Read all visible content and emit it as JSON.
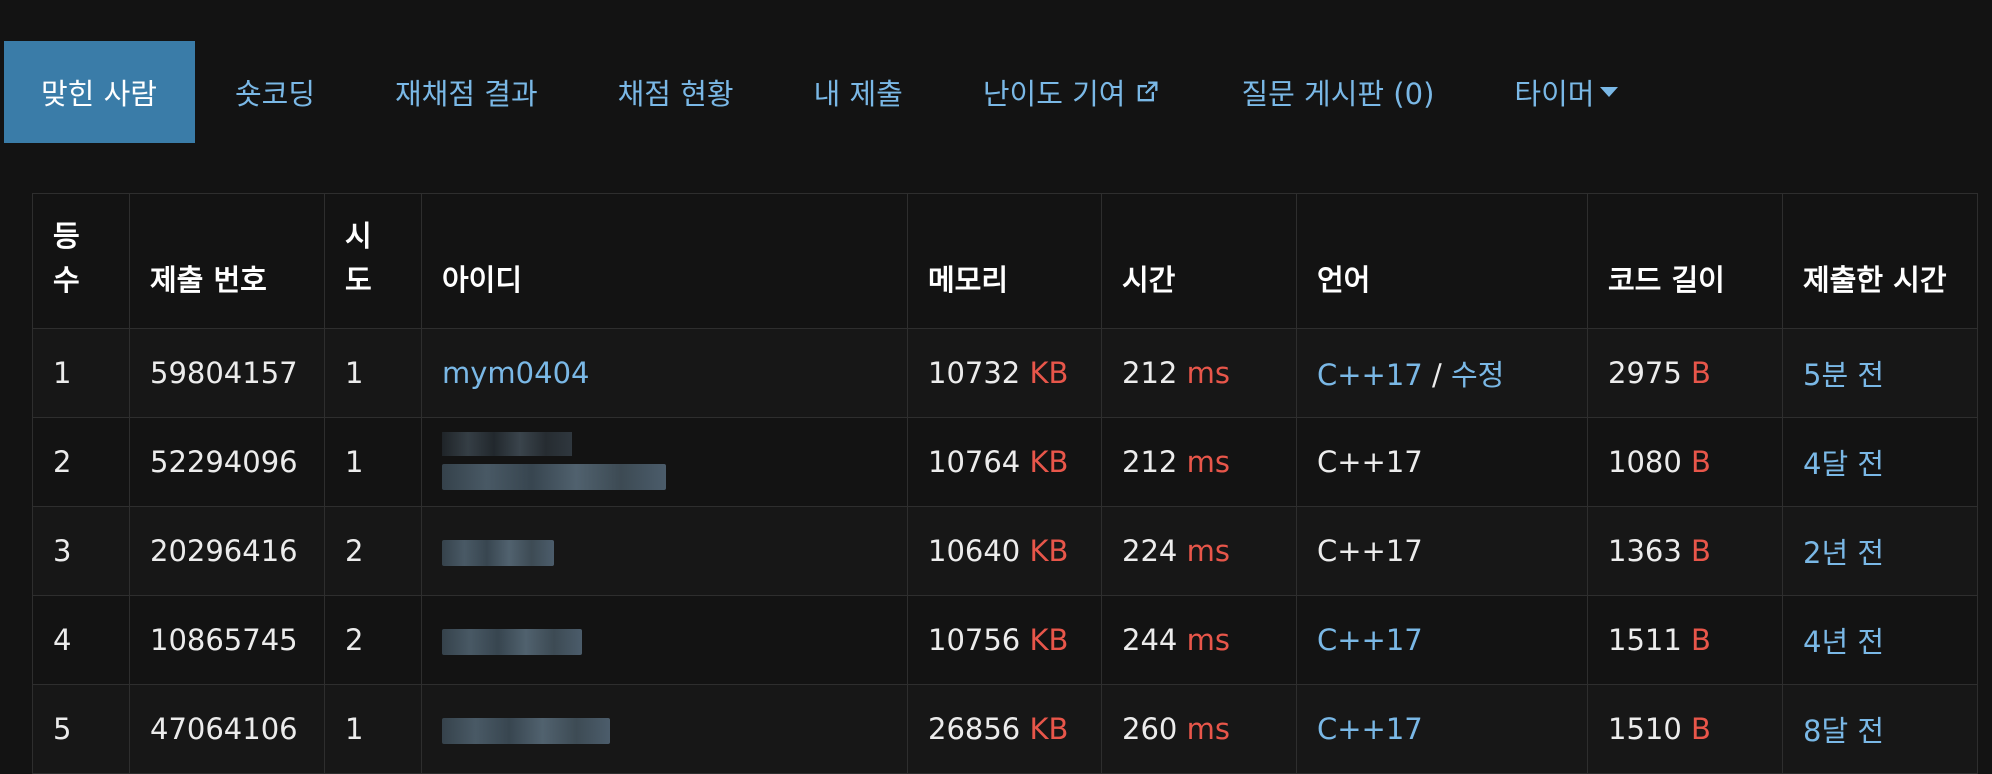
{
  "tabs": [
    {
      "label": "맞힌 사람",
      "active": true
    },
    {
      "label": "숏코딩"
    },
    {
      "label": "재채점 결과"
    },
    {
      "label": "채점 현황"
    },
    {
      "label": "내 제출"
    },
    {
      "label": "난이도 기여",
      "icon": "external-link-icon"
    },
    {
      "label": "질문 게시판 (0)"
    },
    {
      "label": "타이머",
      "icon": "caret-down-icon"
    }
  ],
  "table": {
    "headers": {
      "rank": "등\n수",
      "submission": "제출 번호",
      "tries": "시\n도",
      "user": "아이디",
      "memory": "메모리",
      "time": "시간",
      "language": "언어",
      "code_length": "코드 길이",
      "submitted_at": "제출한 시간"
    },
    "units": {
      "memory": "KB",
      "time": "ms",
      "code_length": "B"
    },
    "rows": [
      {
        "rank": "1",
        "submission": "59804157",
        "tries": "1",
        "user": "mym0404",
        "memory": "10732",
        "time": "212",
        "language": "C++17",
        "language_sep": " / ",
        "language_extra": "수정",
        "code_length": "2975",
        "submitted_at": "5분 전"
      },
      {
        "rank": "2",
        "submission": "52294096",
        "tries": "1",
        "user": "",
        "memory": "10764",
        "time": "212",
        "language": "C++17",
        "code_length": "1080",
        "submitted_at": "4달 전"
      },
      {
        "rank": "3",
        "submission": "20296416",
        "tries": "2",
        "user": "",
        "memory": "10640",
        "time": "224",
        "language": "C++17",
        "code_length": "1363",
        "submitted_at": "2년 전"
      },
      {
        "rank": "4",
        "submission": "10865745",
        "tries": "2",
        "user": "",
        "memory": "10756",
        "time": "244",
        "language": "C++17",
        "code_length": "1511",
        "submitted_at": "4년 전"
      },
      {
        "rank": "5",
        "submission": "47064106",
        "tries": "1",
        "user": "",
        "memory": "26856",
        "time": "260",
        "language": "C++17",
        "code_length": "1510",
        "submitted_at": "8달 전"
      }
    ]
  },
  "colors": {
    "active_tab_bg": "#3a7ca8",
    "link": "#7ab8e6",
    "unit": "#e8564a",
    "background": "#131313"
  }
}
